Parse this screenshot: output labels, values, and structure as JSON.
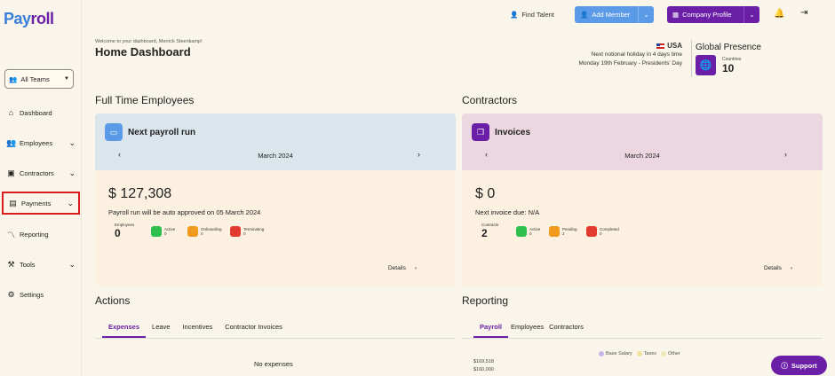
{
  "brand": {
    "part1": "Pay",
    "part2": "roll"
  },
  "sidebar": {
    "team_select": "All Teams",
    "items": [
      {
        "label": "Dashboard"
      },
      {
        "label": "Employees"
      },
      {
        "label": "Contractors"
      },
      {
        "label": "Payments"
      },
      {
        "label": "Reporting"
      },
      {
        "label": "Tools"
      },
      {
        "label": "Settings"
      }
    ]
  },
  "topbar": {
    "find_talent": "Find Talent",
    "add_member": "Add Member",
    "company_profile": "Company Profile"
  },
  "header": {
    "welcome": "Welcome to your dashboard, Merrick Steenkamp!",
    "title": "Home Dashboard",
    "country": "USA",
    "holiday_line1": "Next notional holiday in 4 days time",
    "holiday_line2": "Monday 19th February - Presidents' Day",
    "global_title": "Global Presence",
    "countries_label": "Countries",
    "countries_value": "10"
  },
  "fte": {
    "section_title": "Full Time Employees",
    "card_title": "Next payroll run",
    "month": "March 2024",
    "amount": "$ 127,308",
    "note": "Payroll run will be auto approved on 05 March 2024",
    "main_label": "Employees",
    "main_value": "0",
    "stats": [
      {
        "label": "Active",
        "value": "0",
        "color": "#2fbf4f"
      },
      {
        "label": "Onboarding",
        "value": "0",
        "color": "#f29a1d"
      },
      {
        "label": "Terminating",
        "value": "0",
        "color": "#e23a2e"
      }
    ],
    "details": "Details"
  },
  "contractors": {
    "section_title": "Contractors",
    "card_title": "Invoices",
    "month": "March 2024",
    "amount": "$ 0",
    "note": "Next invoice due: N/A",
    "main_label": "Contracts",
    "main_value": "2",
    "stats": [
      {
        "label": "Active",
        "value": "0",
        "color": "#2fbf4f"
      },
      {
        "label": "Pending",
        "value": "2",
        "color": "#f29a1d"
      },
      {
        "label": "Completed",
        "value": "0",
        "color": "#e23a2e"
      }
    ],
    "details": "Details"
  },
  "actions": {
    "section_title": "Actions",
    "tabs": [
      "Expenses",
      "Leave",
      "Incentives",
      "Contractor Invoices"
    ],
    "empty": "No expenses"
  },
  "reporting": {
    "section_title": "Reporting",
    "tabs": [
      "Payroll",
      "Employees",
      "Contractors"
    ],
    "legend": [
      {
        "label": "Base Salary",
        "color": "#c7b6ea"
      },
      {
        "label": "Taxes",
        "color": "#f3e29b"
      },
      {
        "label": "Other",
        "color": "#f1e8b8"
      }
    ],
    "y_labels": [
      "$169,518",
      "$160,000"
    ]
  },
  "support": "Support",
  "colors": {
    "purple": "#6a1fa6",
    "blue": "#5a9ae6",
    "highlight": "#d81e1e"
  }
}
